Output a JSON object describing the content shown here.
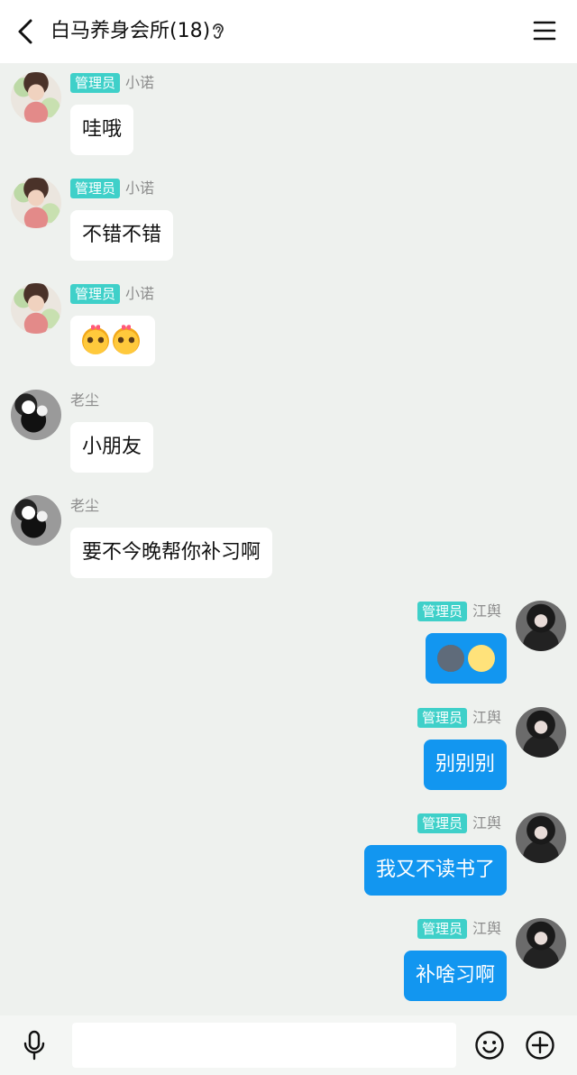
{
  "header": {
    "title": "白马养身会所(18)",
    "ear_icon": "ear-icon",
    "back_icon": "chevron-left-icon",
    "menu_icon": "menu-icon"
  },
  "badge_label": "管理员",
  "messages": [
    {
      "side": "in",
      "avatar": "girl",
      "badge": "管理员",
      "name": "小诺",
      "text": "哇哦"
    },
    {
      "side": "in",
      "avatar": "girl",
      "badge": "管理员",
      "name": "小诺",
      "text": "不错不错"
    },
    {
      "side": "in",
      "avatar": "girl",
      "badge": "管理员",
      "name": "小诺",
      "emoji": [
        "shy-face-emoji",
        "shy-face-emoji"
      ]
    },
    {
      "side": "in",
      "avatar": "bw",
      "name": "老尘",
      "text": "小朋友"
    },
    {
      "side": "in",
      "avatar": "bw",
      "name": "老尘",
      "text": "要不今晚帮你补习啊"
    },
    {
      "side": "out",
      "avatar": "dark",
      "badge": "管理员",
      "name": "江舆",
      "emoji": [
        "new-moon-face-emoji",
        "full-moon-face-emoji"
      ]
    },
    {
      "side": "out",
      "avatar": "dark",
      "badge": "管理员",
      "name": "江舆",
      "text": "别别别"
    },
    {
      "side": "out",
      "avatar": "dark",
      "badge": "管理员",
      "name": "江舆",
      "text": "我又不读书了"
    },
    {
      "side": "out",
      "avatar": "dark",
      "badge": "管理员",
      "name": "江舆",
      "text": "补啥习啊"
    }
  ],
  "input": {
    "value": "",
    "placeholder": ""
  },
  "colors": {
    "background": "#eef1ee",
    "badge": "#3fd0c9",
    "outgoing_bubble": "#1296f0",
    "incoming_bubble": "#ffffff"
  }
}
